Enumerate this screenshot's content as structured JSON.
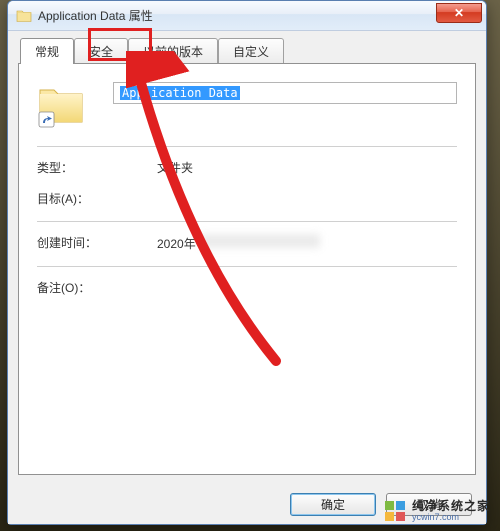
{
  "window": {
    "title": "Application Data 属性",
    "close_glyph": "✕"
  },
  "tabs": [
    {
      "label": "常规"
    },
    {
      "label": "安全"
    },
    {
      "label": "以前的版本"
    },
    {
      "label": "自定义"
    }
  ],
  "general": {
    "name_value": "Application Data",
    "type_label": "类型：",
    "type_value": "文件夹",
    "target_label": "目标(A)：",
    "target_value": "",
    "created_label": "创建时间：",
    "created_value_prefix": "2020年",
    "notes_label": "备注(O)：",
    "notes_value": ""
  },
  "buttons": {
    "ok": "确定",
    "cancel": "取消"
  },
  "watermark": {
    "title": "纯净系统之家",
    "url": "ycwin7.com"
  }
}
